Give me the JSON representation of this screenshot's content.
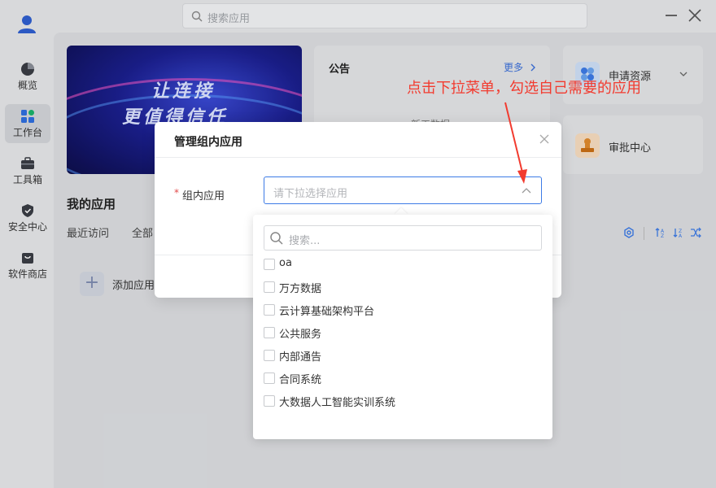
{
  "topbar": {
    "search_placeholder": "搜索应用"
  },
  "sidebar": {
    "items": [
      {
        "label": "概览",
        "icon": "pie-chart-icon",
        "active": false
      },
      {
        "label": "工作台",
        "icon": "grid-icon",
        "active": true
      },
      {
        "label": "工具箱",
        "icon": "toolbox-icon",
        "active": false
      },
      {
        "label": "安全中心",
        "icon": "shield-icon",
        "active": false
      },
      {
        "label": "软件商店",
        "icon": "store-icon",
        "active": false
      }
    ]
  },
  "banner": {
    "line1": "让连接",
    "line2": "更值得信任"
  },
  "notice": {
    "title": "公告",
    "more": "更多",
    "item_partial": "新工数据"
  },
  "quick_actions": [
    {
      "label": "申请资源",
      "icon": "apply-resource-icon"
    },
    {
      "label": "审批中心",
      "icon": "approval-stamp-icon"
    }
  ],
  "my_apps": {
    "title": "我的应用",
    "tabs": [
      "最近访问",
      "全部"
    ],
    "add_label": "添加应用"
  },
  "modal": {
    "title": "管理组内应用",
    "required_mark": "*",
    "field_label": "组内应用",
    "select_placeholder": "请下拉选择应用"
  },
  "dropdown": {
    "search_placeholder": "搜索...",
    "options": [
      "oa",
      "万方数据",
      "云计算基础架构平台",
      "公共服务",
      "内部通告",
      "合同系统",
      "大数据人工智能实训系统"
    ]
  },
  "annotation": {
    "text": "点击下拉菜单，勾选自己需要的应用"
  },
  "colors": {
    "accent": "#3d7be6",
    "annotation": "#f23b2f",
    "required": "#e24b4b"
  }
}
